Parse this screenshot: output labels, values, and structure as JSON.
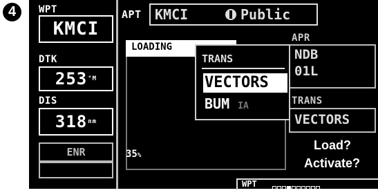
{
  "step_number": "4",
  "left_panel": {
    "wpt_label": "WPT",
    "wpt_value": "KMCI",
    "dtk_label": "DTK",
    "dtk_value": "253",
    "dtk_unit": "°M",
    "dis_label": "DIS",
    "dis_value": "318",
    "dis_unit": "nm",
    "mode": "ENR"
  },
  "header": {
    "apt_label": "APT",
    "apt_id": "KMCI",
    "facility_type": "Public"
  },
  "center": {
    "loading_text": "LOADING",
    "progress_percent": "35",
    "progress_unit": "%"
  },
  "trans_menu": {
    "title": "TRANS",
    "items": [
      {
        "label": "VECTORS",
        "selected": true
      },
      {
        "label": "BUM",
        "tag": "IA",
        "selected": false
      }
    ]
  },
  "right_panel": {
    "apr_label": "APR",
    "apr_value_line1": "NDB",
    "apr_value_line2": "01L",
    "trans_label": "TRANS",
    "trans_value": "VECTORS",
    "load_prompt": "Load?",
    "activate_prompt": "Activate?"
  },
  "status_bar": {
    "page_group": "WPT",
    "page_segments": 10,
    "active_segment": 3
  }
}
